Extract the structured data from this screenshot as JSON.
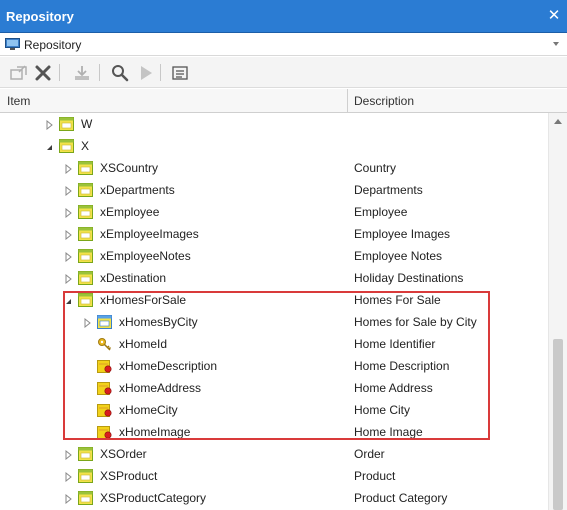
{
  "window": {
    "title": "Repository",
    "close_glyph": "✕"
  },
  "selector": {
    "value": "Repository",
    "icon": "monitor-icon"
  },
  "toolbar": {
    "buttons": [
      {
        "name": "import-icon",
        "enabled": false
      },
      {
        "name": "delete-icon",
        "enabled": true
      },
      {
        "name": "download-icon",
        "enabled": false
      },
      {
        "name": "search-icon",
        "enabled": true
      },
      {
        "name": "play-icon",
        "enabled": false
      },
      {
        "name": "list-icon",
        "enabled": true
      }
    ]
  },
  "columns": {
    "item": "Item",
    "description": "Description"
  },
  "tree": [
    {
      "name": "W",
      "desc": "",
      "level": 0,
      "expander": "closed",
      "icon": "table-icon"
    },
    {
      "name": "X",
      "desc": "",
      "level": 0,
      "expander": "open",
      "icon": "table-icon"
    },
    {
      "name": "XSCountry",
      "desc": "Country",
      "level": 1,
      "expander": "closed",
      "icon": "table-icon"
    },
    {
      "name": "xDepartments",
      "desc": "Departments",
      "level": 1,
      "expander": "closed",
      "icon": "table-icon"
    },
    {
      "name": "xEmployee",
      "desc": "Employee",
      "level": 1,
      "expander": "closed",
      "icon": "table-icon"
    },
    {
      "name": "xEmployeeImages",
      "desc": "Employee Images",
      "level": 1,
      "expander": "closed",
      "icon": "table-icon"
    },
    {
      "name": "xEmployeeNotes",
      "desc": "Employee Notes",
      "level": 1,
      "expander": "closed",
      "icon": "table-icon"
    },
    {
      "name": "xDestination",
      "desc": "Holiday Destinations",
      "level": 1,
      "expander": "closed",
      "icon": "table-icon"
    },
    {
      "name": "xHomesForSale",
      "desc": "Homes For Sale",
      "level": 1,
      "expander": "open",
      "icon": "table-icon"
    },
    {
      "name": "xHomesByCity",
      "desc": "Homes for Sale by City",
      "level": 2,
      "expander": "closed",
      "icon": "view-icon"
    },
    {
      "name": "xHomeId",
      "desc": "Home Identifier",
      "level": 2,
      "expander": "none",
      "icon": "key-icon"
    },
    {
      "name": "xHomeDescription",
      "desc": "Home Description",
      "level": 2,
      "expander": "none",
      "icon": "field-icon"
    },
    {
      "name": "xHomeAddress",
      "desc": "Home Address",
      "level": 2,
      "expander": "none",
      "icon": "field-icon"
    },
    {
      "name": "xHomeCity",
      "desc": "Home City",
      "level": 2,
      "expander": "none",
      "icon": "field-icon"
    },
    {
      "name": "xHomeImage",
      "desc": "Home Image",
      "level": 2,
      "expander": "none",
      "icon": "field-icon"
    },
    {
      "name": "XSOrder",
      "desc": "Order",
      "level": 1,
      "expander": "closed",
      "icon": "table-icon"
    },
    {
      "name": "XSProduct",
      "desc": "Product",
      "level": 1,
      "expander": "closed",
      "icon": "table-icon"
    },
    {
      "name": "XSProductCategory",
      "desc": "Product Category",
      "level": 1,
      "expander": "closed",
      "icon": "table-icon"
    }
  ],
  "colors": {
    "titlebar": "#2b7cd3",
    "highlight": "#d93a3a"
  }
}
